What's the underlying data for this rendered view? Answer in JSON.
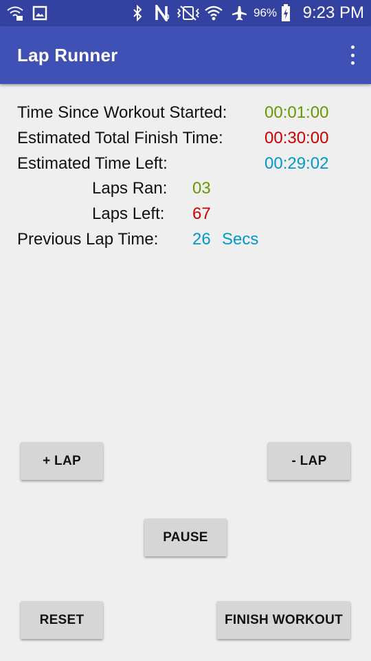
{
  "status_bar": {
    "battery": "96%",
    "clock": "9:23 PM",
    "icons": [
      "wifi-calling-icon",
      "gallery-icon",
      "bluetooth-icon",
      "nfc-icon",
      "vibrate-icon",
      "wifi-icon",
      "airplane-mode-icon",
      "battery-charging-icon"
    ]
  },
  "app_bar": {
    "title": "Lap Runner",
    "overflow_icon": "more-vert-icon"
  },
  "stats": {
    "time_since_started": {
      "label": "Time Since Workout Started:",
      "value": "00:01:00",
      "color": "#669900"
    },
    "estimated_total": {
      "label": "Estimated Total Finish Time:",
      "value": "00:30:00",
      "color": "#cc0000"
    },
    "time_left": {
      "label": "Estimated Time Left:",
      "value": "00:29:02",
      "color": "#0099cc"
    },
    "laps_ran": {
      "label": "Laps Ran:",
      "value": "03",
      "color": "#669900"
    },
    "laps_left": {
      "label": "Laps Left:",
      "value": "67",
      "color": "#cc0000"
    },
    "previous_lap": {
      "label": "Previous Lap Time:",
      "value": "26",
      "unit": "Secs",
      "color": "#0099cc"
    }
  },
  "buttons": {
    "add_lap": "+ LAP",
    "remove_lap": "- LAP",
    "pause": "PAUSE",
    "reset": "RESET",
    "finish": "FINISH WORKOUT"
  }
}
